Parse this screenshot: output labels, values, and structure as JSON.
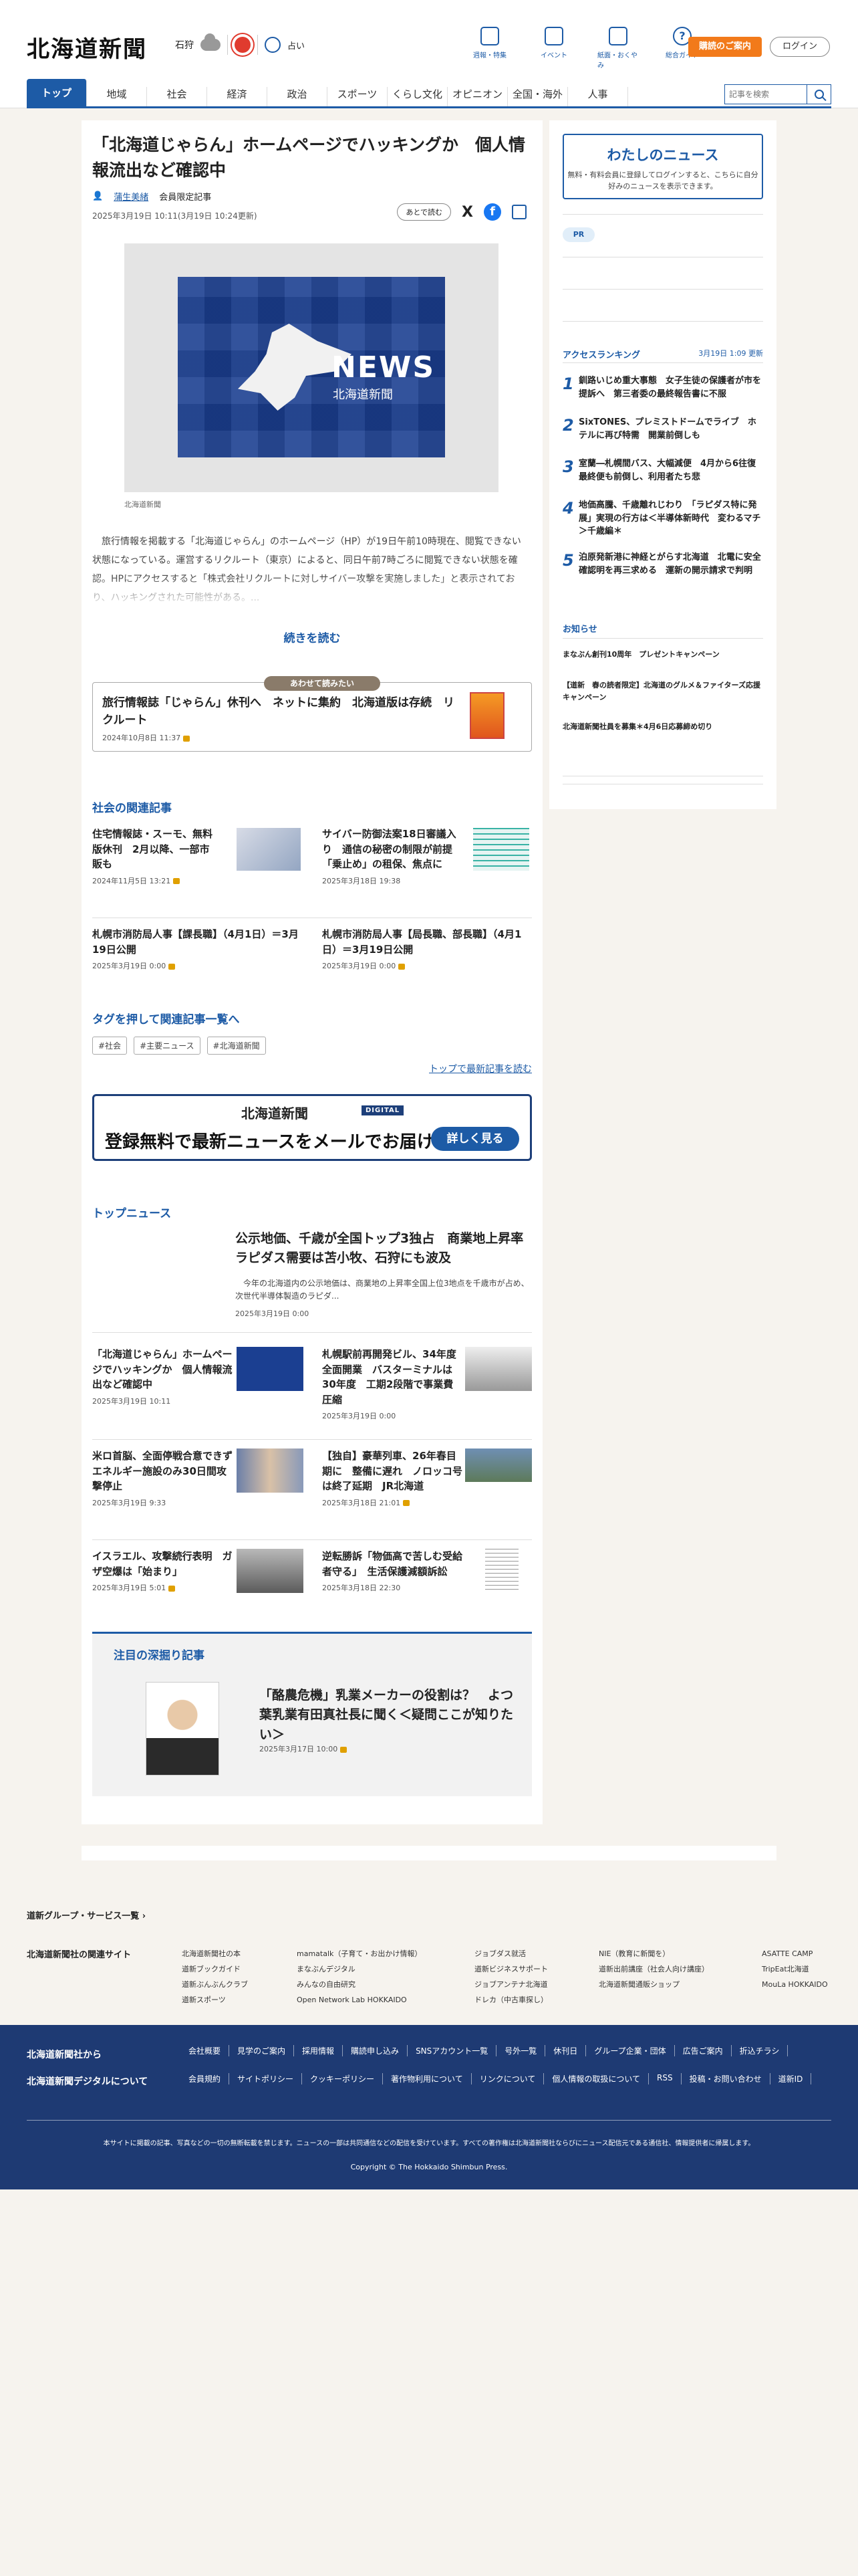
{
  "header": {
    "logo": "北海道新聞",
    "weather_city": "石狩",
    "fortune": "占い",
    "tools": [
      "週報・特集",
      "イベント",
      "紙面・おくやみ",
      "総合ガイド"
    ],
    "subscribe": "購読のご案内",
    "login": "ログイン"
  },
  "nav": {
    "items": [
      "トップ",
      "地域",
      "社会",
      "経済",
      "政治",
      "スポーツ",
      "くらし文化",
      "オピニオン",
      "全国・海外",
      "人事"
    ],
    "search_placeholder": "記事を検索"
  },
  "article": {
    "title": "「北海道じゃらん」ホームページでハッキングか　個人情報流出など確認中",
    "author": "蒲生美緒",
    "membership": "会員限定記事",
    "date": "2025年3月19日 10:11(3月19日 10:24更新)",
    "save_later": "あとで読む",
    "photo_caption": "北海道新聞",
    "photo_news": "NEWS",
    "photo_sub": "北海道新聞",
    "lead": "　旅行情報を掲載する「北海道じゃらん」のホームページ（HP）が19日午前10時現在、閲覧できない状態になっている。運営するリクルート（東京）によると、同日午前7時ごろに閲覧できない状態を確認。HPにアクセスすると「株式会社リクルートに対しサイバー攻撃を実施しました」と表示されており、ハッキングされた可能性がある。...",
    "read_more": "続きを読む"
  },
  "also_read": {
    "badge": "あわせて読みたい",
    "title": "旅行情報誌「じゃらん」休刊へ　ネットに集約　北海道版は存続　リクルート",
    "date": "2024年10月8日 11:37"
  },
  "related": {
    "heading": "社会の関連記事",
    "items": [
      {
        "title": "住宅情報誌・スーモ、無料版休刊　2月以降、一部市販も",
        "date": "2024年11月5日 13:21"
      },
      {
        "title": "サイバー防御法案18日審議入り　通信の秘密の制限が前提　「乗止め」の租保、焦点に",
        "date": "2025年3月18日 19:38"
      },
      {
        "title": "札幌市消防局人事【課長職】（4月1日）＝3月19日公開",
        "date": "2025年3月19日 0:00"
      },
      {
        "title": "札幌市消防局人事【局長職、部長職】（4月1日）＝3月19日公開",
        "date": "2025年3月19日 0:00"
      }
    ]
  },
  "tags": {
    "heading": "タグを押して関連記事一覧へ",
    "items": [
      "#社会",
      "#主要ニュース",
      "#北海道新聞"
    ],
    "to_latest": "トップで最新記事を読む"
  },
  "banner": {
    "logo": "北海道新聞",
    "digital": "DIGITAL",
    "text": "登録無料で最新ニュースをメールでお届け",
    "button": "詳しく見る"
  },
  "top_news": {
    "heading": "トップニュース",
    "lead_title": "公示地価、千歳が全国トップ3独占　商業地上昇率　ラピダス需要は苫小牧、石狩にも波及",
    "lead_summary": "　今年の北海道内の公示地価は、商業地の上昇率全国上位3地点を千歳市が占め、次世代半導体製造のラピダ...",
    "lead_date": "2025年3月19日 0:00",
    "items": [
      {
        "title": "「北海道じゃらん」ホームページでハッキングか　個人情報流出など確認中",
        "date": "2025年3月19日 10:11"
      },
      {
        "title": "札幌駅前再開発ビル、34年度全面開業　バスターミナルは30年度　工期2段階で事業費圧縮",
        "date": "2025年3月19日 0:00"
      },
      {
        "title": "米ロ首脳、全面停戦合意できず　エネルギー施設のみ30日間攻撃停止",
        "date": "2025年3月19日 9:33"
      },
      {
        "title": "【独自】豪華列車、26年春目期に　整備に遅れ　ノロッコ号は終了延期　JR北海道",
        "date": "2025年3月18日 21:01"
      },
      {
        "title": "イスラエル、攻撃続行表明　ガザ空爆は「始まり」",
        "date": "2025年3月19日 5:01"
      },
      {
        "title": "逆転勝訴「物価高で苦しむ受給者守る」　生活保護減額訴訟",
        "date": "2025年3月18日 22:30"
      }
    ]
  },
  "deep_dive": {
    "heading": "注目の深掘り記事",
    "title": "「酪農危機」乳業メーカーの役割は？　よつ葉乳業有田真社長に聞く＜疑問ここが知りたい＞",
    "date": "2025年3月17日 10:00"
  },
  "sidebar": {
    "mynews_title": "わたしのニュース",
    "mynews_text": "無料・有料会員に登録してログインすると、こちらに自分好みのニュースを表示できます。",
    "pr": "PR",
    "ranking_heading": "アクセスランキング",
    "ranking_updated": "3月19日 1:09 更新",
    "ranking": [
      "釧路いじめ重大事態　女子生徒の保護者が市を提訴へ　第三者委の最終報告書に不服",
      "SixTONES、プレミストドームでライブ　ホテルに再び特需　開業前倒しも",
      "室蘭―札幌間バス、大幅減便　4月から6往復　最終便も前倒し、利用者たち悲",
      "地価高騰、千歳離れじわり　「ラピダス特に発展」実現の行方は＜半導体新時代　変わるマチ＞千歳編＊",
      "泊原発新港に神経とがらす北海道　北電に安全確認明を再三求める　運新の開示請求で判明"
    ],
    "notice_heading": "お知らせ",
    "notices": [
      "まなぶん創刊10周年　プレゼントキャンペーン",
      "【道新　春の読者限定】北海道のグルメ＆ファイターズ応援キャンペーン",
      "北海道新聞社員を募集＊4月6日応募締め切り"
    ]
  },
  "footer": {
    "group_link": "道新グループ・サービス一覧",
    "related_sites_heading": "北海道新聞社の関連サイト",
    "related_sites": [
      [
        "北海道新聞社の本",
        "道新ブックガイド",
        "道新ぶんぶんクラブ",
        "道新スポーツ"
      ],
      [
        "mamatalk（子育て・お出かけ情報）",
        "まなぶんデジタル",
        "みんなの自由研究",
        "Open Network Lab HOKKAIDO"
      ],
      [
        "ジョブダス就活",
        "道新ビジネスサポート",
        "ジョブアンテナ北海道",
        "ドレカ（中古車探し）"
      ],
      [
        "NIE（教育に新聞を）",
        "道新出前講座（社会人向け講座）",
        "北海道新聞通販ショップ"
      ],
      [
        "ASATTE CAMP",
        "TripEat北海道",
        "MouLa HOKKAIDO"
      ]
    ],
    "side_1": "北海道新聞社から",
    "side_2": "北海道新聞デジタルについて",
    "links_1": [
      "会社概要",
      "見学のご案内",
      "採用情報",
      "購読申し込み",
      "SNSアカウント一覧",
      "号外一覧",
      "休刊日",
      "グループ企業・団体",
      "広告ご案内",
      "折込チラシ"
    ],
    "links_2": [
      "会員規約",
      "サイトポリシー",
      "クッキーポリシー",
      "著作物利用について",
      "リンクについて",
      "個人情報の取扱について",
      "RSS",
      "投稿・お問い合わせ",
      "道新ID"
    ],
    "note": "本サイトに掲載の記事、写真などの一切の無断転載を禁じます。ニュースの一部は共同通信などの配信を受けています。すべての著作権は北海道新聞社ならびにニュース配信元である通信社、情報提供者に帰属します。",
    "copyright": "Copyright © The Hokkaido Shimbun Press."
  }
}
